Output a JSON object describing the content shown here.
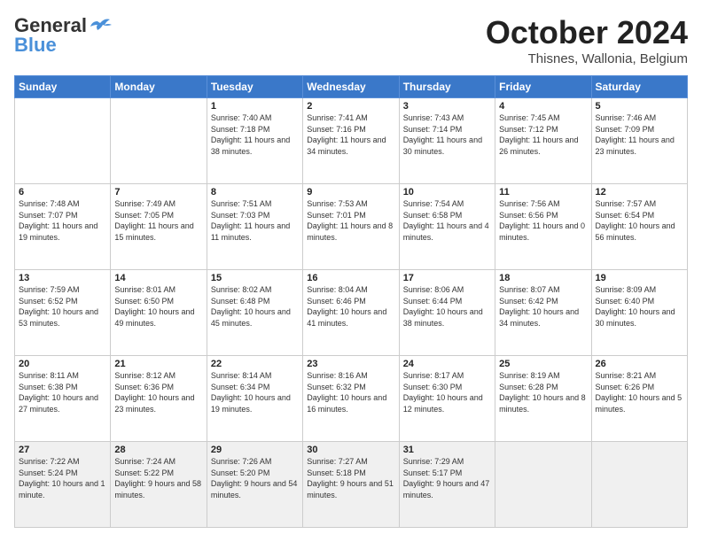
{
  "logo": {
    "general": "General",
    "blue": "Blue"
  },
  "header": {
    "month": "October 2024",
    "location": "Thisnes, Wallonia, Belgium"
  },
  "weekdays": [
    "Sunday",
    "Monday",
    "Tuesday",
    "Wednesday",
    "Thursday",
    "Friday",
    "Saturday"
  ],
  "weeks": [
    [
      {
        "day": "",
        "sunrise": "",
        "sunset": "",
        "daylight": ""
      },
      {
        "day": "",
        "sunrise": "",
        "sunset": "",
        "daylight": ""
      },
      {
        "day": "1",
        "sunrise": "Sunrise: 7:40 AM",
        "sunset": "Sunset: 7:18 PM",
        "daylight": "Daylight: 11 hours and 38 minutes."
      },
      {
        "day": "2",
        "sunrise": "Sunrise: 7:41 AM",
        "sunset": "Sunset: 7:16 PM",
        "daylight": "Daylight: 11 hours and 34 minutes."
      },
      {
        "day": "3",
        "sunrise": "Sunrise: 7:43 AM",
        "sunset": "Sunset: 7:14 PM",
        "daylight": "Daylight: 11 hours and 30 minutes."
      },
      {
        "day": "4",
        "sunrise": "Sunrise: 7:45 AM",
        "sunset": "Sunset: 7:12 PM",
        "daylight": "Daylight: 11 hours and 26 minutes."
      },
      {
        "day": "5",
        "sunrise": "Sunrise: 7:46 AM",
        "sunset": "Sunset: 7:09 PM",
        "daylight": "Daylight: 11 hours and 23 minutes."
      }
    ],
    [
      {
        "day": "6",
        "sunrise": "Sunrise: 7:48 AM",
        "sunset": "Sunset: 7:07 PM",
        "daylight": "Daylight: 11 hours and 19 minutes."
      },
      {
        "day": "7",
        "sunrise": "Sunrise: 7:49 AM",
        "sunset": "Sunset: 7:05 PM",
        "daylight": "Daylight: 11 hours and 15 minutes."
      },
      {
        "day": "8",
        "sunrise": "Sunrise: 7:51 AM",
        "sunset": "Sunset: 7:03 PM",
        "daylight": "Daylight: 11 hours and 11 minutes."
      },
      {
        "day": "9",
        "sunrise": "Sunrise: 7:53 AM",
        "sunset": "Sunset: 7:01 PM",
        "daylight": "Daylight: 11 hours and 8 minutes."
      },
      {
        "day": "10",
        "sunrise": "Sunrise: 7:54 AM",
        "sunset": "Sunset: 6:58 PM",
        "daylight": "Daylight: 11 hours and 4 minutes."
      },
      {
        "day": "11",
        "sunrise": "Sunrise: 7:56 AM",
        "sunset": "Sunset: 6:56 PM",
        "daylight": "Daylight: 11 hours and 0 minutes."
      },
      {
        "day": "12",
        "sunrise": "Sunrise: 7:57 AM",
        "sunset": "Sunset: 6:54 PM",
        "daylight": "Daylight: 10 hours and 56 minutes."
      }
    ],
    [
      {
        "day": "13",
        "sunrise": "Sunrise: 7:59 AM",
        "sunset": "Sunset: 6:52 PM",
        "daylight": "Daylight: 10 hours and 53 minutes."
      },
      {
        "day": "14",
        "sunrise": "Sunrise: 8:01 AM",
        "sunset": "Sunset: 6:50 PM",
        "daylight": "Daylight: 10 hours and 49 minutes."
      },
      {
        "day": "15",
        "sunrise": "Sunrise: 8:02 AM",
        "sunset": "Sunset: 6:48 PM",
        "daylight": "Daylight: 10 hours and 45 minutes."
      },
      {
        "day": "16",
        "sunrise": "Sunrise: 8:04 AM",
        "sunset": "Sunset: 6:46 PM",
        "daylight": "Daylight: 10 hours and 41 minutes."
      },
      {
        "day": "17",
        "sunrise": "Sunrise: 8:06 AM",
        "sunset": "Sunset: 6:44 PM",
        "daylight": "Daylight: 10 hours and 38 minutes."
      },
      {
        "day": "18",
        "sunrise": "Sunrise: 8:07 AM",
        "sunset": "Sunset: 6:42 PM",
        "daylight": "Daylight: 10 hours and 34 minutes."
      },
      {
        "day": "19",
        "sunrise": "Sunrise: 8:09 AM",
        "sunset": "Sunset: 6:40 PM",
        "daylight": "Daylight: 10 hours and 30 minutes."
      }
    ],
    [
      {
        "day": "20",
        "sunrise": "Sunrise: 8:11 AM",
        "sunset": "Sunset: 6:38 PM",
        "daylight": "Daylight: 10 hours and 27 minutes."
      },
      {
        "day": "21",
        "sunrise": "Sunrise: 8:12 AM",
        "sunset": "Sunset: 6:36 PM",
        "daylight": "Daylight: 10 hours and 23 minutes."
      },
      {
        "day": "22",
        "sunrise": "Sunrise: 8:14 AM",
        "sunset": "Sunset: 6:34 PM",
        "daylight": "Daylight: 10 hours and 19 minutes."
      },
      {
        "day": "23",
        "sunrise": "Sunrise: 8:16 AM",
        "sunset": "Sunset: 6:32 PM",
        "daylight": "Daylight: 10 hours and 16 minutes."
      },
      {
        "day": "24",
        "sunrise": "Sunrise: 8:17 AM",
        "sunset": "Sunset: 6:30 PM",
        "daylight": "Daylight: 10 hours and 12 minutes."
      },
      {
        "day": "25",
        "sunrise": "Sunrise: 8:19 AM",
        "sunset": "Sunset: 6:28 PM",
        "daylight": "Daylight: 10 hours and 8 minutes."
      },
      {
        "day": "26",
        "sunrise": "Sunrise: 8:21 AM",
        "sunset": "Sunset: 6:26 PM",
        "daylight": "Daylight: 10 hours and 5 minutes."
      }
    ],
    [
      {
        "day": "27",
        "sunrise": "Sunrise: 7:22 AM",
        "sunset": "Sunset: 5:24 PM",
        "daylight": "Daylight: 10 hours and 1 minute."
      },
      {
        "day": "28",
        "sunrise": "Sunrise: 7:24 AM",
        "sunset": "Sunset: 5:22 PM",
        "daylight": "Daylight: 9 hours and 58 minutes."
      },
      {
        "day": "29",
        "sunrise": "Sunrise: 7:26 AM",
        "sunset": "Sunset: 5:20 PM",
        "daylight": "Daylight: 9 hours and 54 minutes."
      },
      {
        "day": "30",
        "sunrise": "Sunrise: 7:27 AM",
        "sunset": "Sunset: 5:18 PM",
        "daylight": "Daylight: 9 hours and 51 minutes."
      },
      {
        "day": "31",
        "sunrise": "Sunrise: 7:29 AM",
        "sunset": "Sunset: 5:17 PM",
        "daylight": "Daylight: 9 hours and 47 minutes."
      },
      {
        "day": "",
        "sunrise": "",
        "sunset": "",
        "daylight": ""
      },
      {
        "day": "",
        "sunrise": "",
        "sunset": "",
        "daylight": ""
      }
    ]
  ]
}
